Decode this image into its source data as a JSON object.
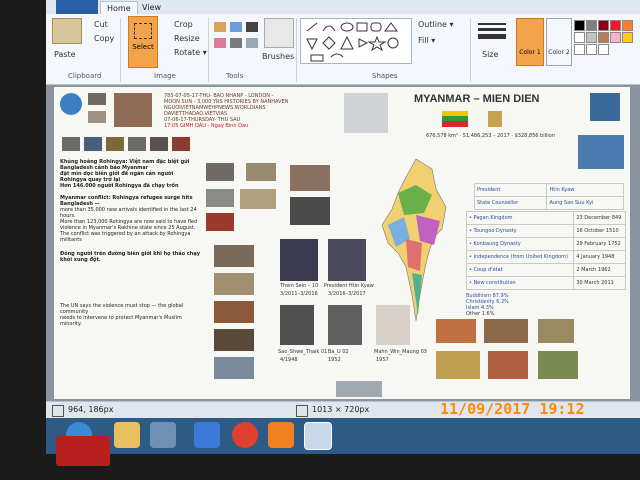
{
  "app": {
    "tabs": [
      "Home",
      "View"
    ],
    "clipboard": {
      "paste": "Paste",
      "cut": "Cut",
      "copy": "Copy",
      "label": "Clipboard"
    },
    "image": {
      "select": "Select",
      "crop": "Crop",
      "resize": "Resize",
      "rotate": "Rotate ▾",
      "label": "Image"
    },
    "tools": {
      "label": "Tools"
    },
    "brushes": {
      "label": "Brushes"
    },
    "shapes": {
      "outline": "Outline ▾",
      "fill": "Fill ▾",
      "label": "Shapes"
    },
    "size": {
      "label": "Size"
    },
    "colors": {
      "color1": "Color 1",
      "color2": "Color 2"
    }
  },
  "document": {
    "title": "MYANMAR – MIEN DIEN",
    "header_lines": [
      "785-07-05-17-THU- BAO NHANP - LONDON -",
      "MOON SUN - 3,000 YRS HISTORIES BY NANHAVEN",
      "NGUOIVIETNAMWEHPNEWS.WORLDIANS",
      "DAVIETTHADAO.VIETVIAS",
      "07-06-17-THURSDAY- THU SAU",
      "17:05 GIMH DAU - Ngay Binh Dau"
    ],
    "stats": "676,578 km² · 51,486,253 – 2017 · $328,856 billion",
    "table": [
      [
        "President",
        "Htin Kyaw"
      ],
      [
        "State Counsellor",
        "Aung San Suu Kyi"
      ]
    ],
    "dynasties": [
      [
        "• Pagan Kingdom",
        "23 December 849"
      ],
      [
        "• Toungoo Dynasty",
        "16 October 1510"
      ],
      [
        "• Konbaung Dynasty",
        "29 February 1752"
      ],
      [
        "• Independence (from United Kingdom)",
        "4 January 1948"
      ],
      [
        "• Coup d'état",
        "2 March 1962"
      ],
      [
        "• New constitution",
        "30 March 2011"
      ]
    ],
    "religion": [
      "Buddhism 87.9%",
      "Christianity 6.2%",
      "Islam 4.3%",
      "Other 1.6%"
    ],
    "left_text": [
      "Khủng hoảng Rohingya: Việt nam đặc biệt gửi Bangladesh cảnh báo Myanmar",
      "đặt mìn dọc biên giới để ngăn cản người Rohingya quay trở lại",
      "Hơn 146.000 người Rohingya đã chạy trốn",
      "Myanmar conflict: Rohingya refugee surge hits Bangladesh —",
      "more than 35,000 new arrivals identified in the last 24 hours.",
      "More than 123,000 Rohingya are now said to have fled",
      "violence in Myanmar's Rakhine state since 25 August.",
      "The conflict was triggered by an attack by Rohingya militants",
      "Đông người trên đường biên giới khi họ tháo chạy khỏi xung đột.",
      "The UN says the violence must stop — the global community",
      "needs to intervene to protect Myanmar's Muslim minority."
    ],
    "captions": [
      "Thein Sein – 10",
      "President Htin Kyaw",
      "Sao_Shwe_Thaik 01",
      "Ba_U 02",
      "Mahn_Win_Maung 03"
    ],
    "caption_years": [
      "3/2011–3/2016",
      "3/2016–3/2017",
      "4/1948",
      "1952",
      "1957"
    ]
  },
  "statusbar": {
    "cursor": "964, 186px",
    "size": "1013 × 720px"
  },
  "camera_stamp": "11/09/2017 19:12",
  "colors": {
    "accent": "#f3a34a",
    "taskbar": "#2e5a86"
  }
}
